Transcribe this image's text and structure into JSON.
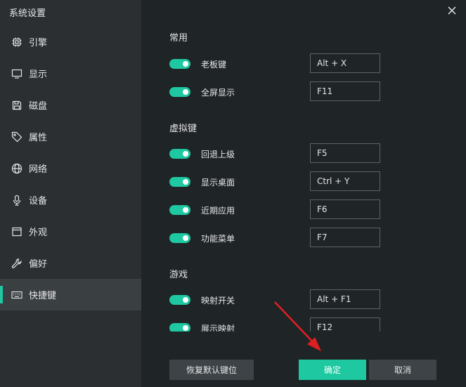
{
  "app": {
    "title": "系统设置"
  },
  "sidebar": {
    "items": [
      {
        "label": "引擎",
        "icon": "chip-icon"
      },
      {
        "label": "显示",
        "icon": "monitor-icon"
      },
      {
        "label": "磁盘",
        "icon": "save-icon"
      },
      {
        "label": "属性",
        "icon": "tag-icon"
      },
      {
        "label": "网络",
        "icon": "globe-icon"
      },
      {
        "label": "设备",
        "icon": "microphone-icon"
      },
      {
        "label": "外观",
        "icon": "window-icon"
      },
      {
        "label": "偏好",
        "icon": "wrench-icon"
      },
      {
        "label": "快捷键",
        "icon": "keyboard-icon",
        "active": true
      }
    ]
  },
  "sections": {
    "common": {
      "title": "常用",
      "rows": [
        {
          "label": "老板键",
          "key": "Alt + X",
          "enabled": true
        },
        {
          "label": "全屏显示",
          "key": "F11",
          "enabled": true
        }
      ]
    },
    "virtual": {
      "title": "虚拟键",
      "rows": [
        {
          "label": "回退上级",
          "key": "F5",
          "enabled": true
        },
        {
          "label": "显示桌面",
          "key": "Ctrl + Y",
          "enabled": true
        },
        {
          "label": "近期应用",
          "key": "F6",
          "enabled": true
        },
        {
          "label": "功能菜单",
          "key": "F7",
          "enabled": true
        }
      ]
    },
    "game": {
      "title": "游戏",
      "rows": [
        {
          "label": "映射开关",
          "key": "Alt + F1",
          "enabled": true
        },
        {
          "label": "展示映射",
          "key": "F12",
          "enabled": true
        }
      ]
    }
  },
  "buttons": {
    "reset": "恢复默认键位",
    "ok": "确定",
    "cancel": "取消"
  },
  "colors": {
    "accent": "#1ec8a0",
    "annotation_arrow": "#e02020"
  }
}
